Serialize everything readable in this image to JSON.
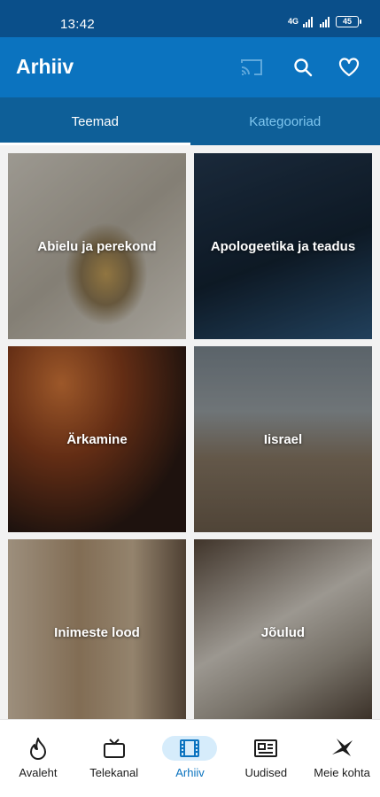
{
  "status": {
    "time": "13:42",
    "network": "4G",
    "battery": "45"
  },
  "appbar": {
    "title": "Arhiiv",
    "icons": [
      "cast-icon",
      "search-icon",
      "heart-icon"
    ]
  },
  "tabs": [
    {
      "label": "Teemad",
      "active": true
    },
    {
      "label": "Kategooriad",
      "active": false
    }
  ],
  "topics": [
    {
      "label": "Abielu ja perekond",
      "icon": "wedding-rings-image"
    },
    {
      "label": "Apologeetika ja teadus",
      "icon": "dna-helix-image"
    },
    {
      "label": "Ärkamine",
      "icon": "worship-crowd-image"
    },
    {
      "label": "Iisrael",
      "icon": "israel-flag-image"
    },
    {
      "label": "Inimeste lood",
      "icon": "wooden-cross-image"
    },
    {
      "label": "Jõulud",
      "icon": "open-bible-image"
    }
  ],
  "nav": [
    {
      "label": "Avaleht",
      "icon": "flame-icon"
    },
    {
      "label": "Telekanal",
      "icon": "tv-icon"
    },
    {
      "label": "Arhiiv",
      "icon": "film-icon",
      "active": true
    },
    {
      "label": "Uudised",
      "icon": "newspaper-icon"
    },
    {
      "label": "Meie kohta",
      "icon": "bird-icon"
    }
  ],
  "colors": {
    "primary": "#0b73bf",
    "tab_bar": "#0e5f98",
    "status_bar": "#0a4f8a"
  }
}
